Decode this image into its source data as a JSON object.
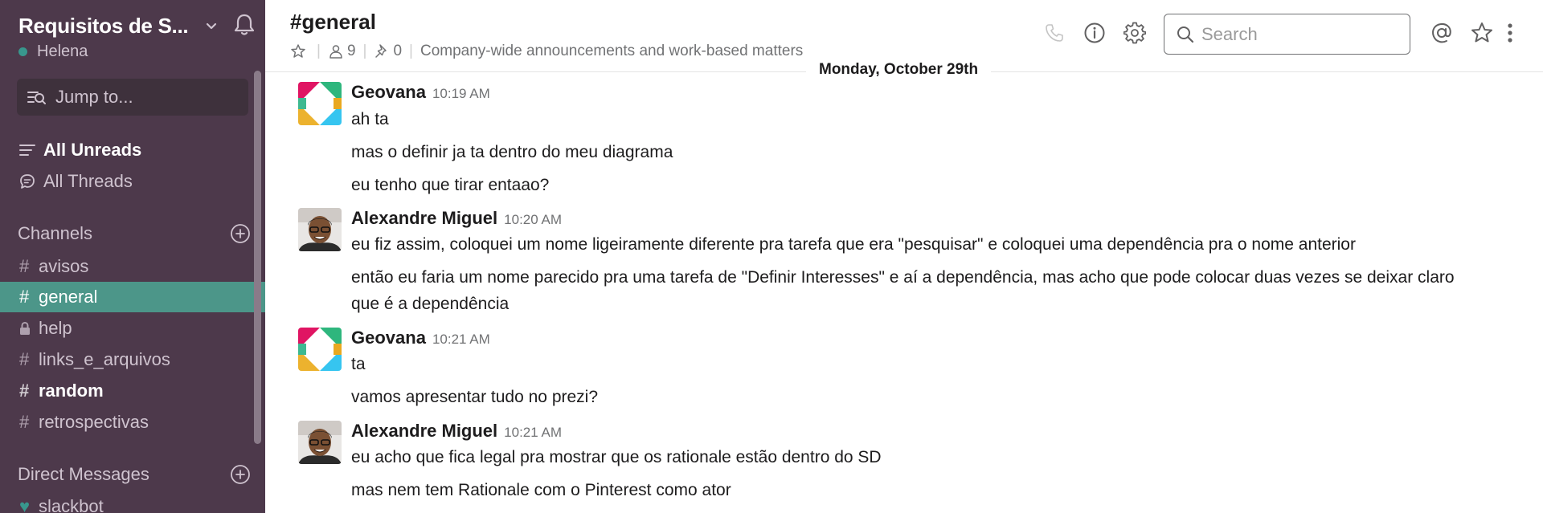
{
  "workspace": {
    "name": "Requisitos de S...",
    "user": "Helena"
  },
  "sidebar": {
    "jump_label": "Jump to...",
    "all_unreads": "All Unreads",
    "all_threads": "All Threads",
    "channels_heading": "Channels",
    "channels": [
      {
        "name": "avisos",
        "prefix": "#"
      },
      {
        "name": "general",
        "prefix": "#"
      },
      {
        "name": "help",
        "prefix": "lock"
      },
      {
        "name": "links_e_arquivos",
        "prefix": "#"
      },
      {
        "name": "random",
        "prefix": "#"
      },
      {
        "name": "retrospectivas",
        "prefix": "#"
      }
    ],
    "dm_heading": "Direct Messages",
    "dms": [
      {
        "name": "slackbot"
      }
    ]
  },
  "header": {
    "channel_title": "#general",
    "member_count": "9",
    "pinned_count": "0",
    "topic": "Company-wide announcements and work-based matters",
    "search_placeholder": "Search"
  },
  "day_divider": "Monday, October 29th",
  "messages": [
    {
      "sender": "Geovana",
      "time": "10:19 AM",
      "avatar": "slack-logo-icon",
      "lines": [
        "ah ta",
        "mas o definir ja ta dentro do meu diagrama",
        "eu tenho que tirar entaao?"
      ]
    },
    {
      "sender": "Alexandre Miguel",
      "time": "10:20 AM",
      "avatar": "person-photo",
      "lines": [
        "eu fiz assim, coloquei um nome ligeiramente diferente pra tarefa que era \"pesquisar\" e coloquei uma dependência pra o nome anterior",
        "então eu faria um nome parecido pra uma tarefa de \"Definir Interesses\" e aí a dependência, mas acho que pode colocar duas vezes se deixar claro",
        "que é a dependência"
      ]
    },
    {
      "sender": "Geovana",
      "time": "10:21 AM",
      "avatar": "slack-logo-icon",
      "lines": [
        "ta",
        "vamos apresentar tudo no prezi?"
      ]
    },
    {
      "sender": "Alexandre Miguel",
      "time": "10:21 AM",
      "avatar": "person-photo",
      "lines": [
        "eu acho que fica legal pra mostrar que os rationale estão dentro do SD",
        "mas nem tem Rationale com o Pinterest como ator"
      ]
    }
  ],
  "colors": {
    "sidebar_bg": "#4d394b",
    "active_channel": "#4c9689",
    "presence": "#38978d"
  }
}
